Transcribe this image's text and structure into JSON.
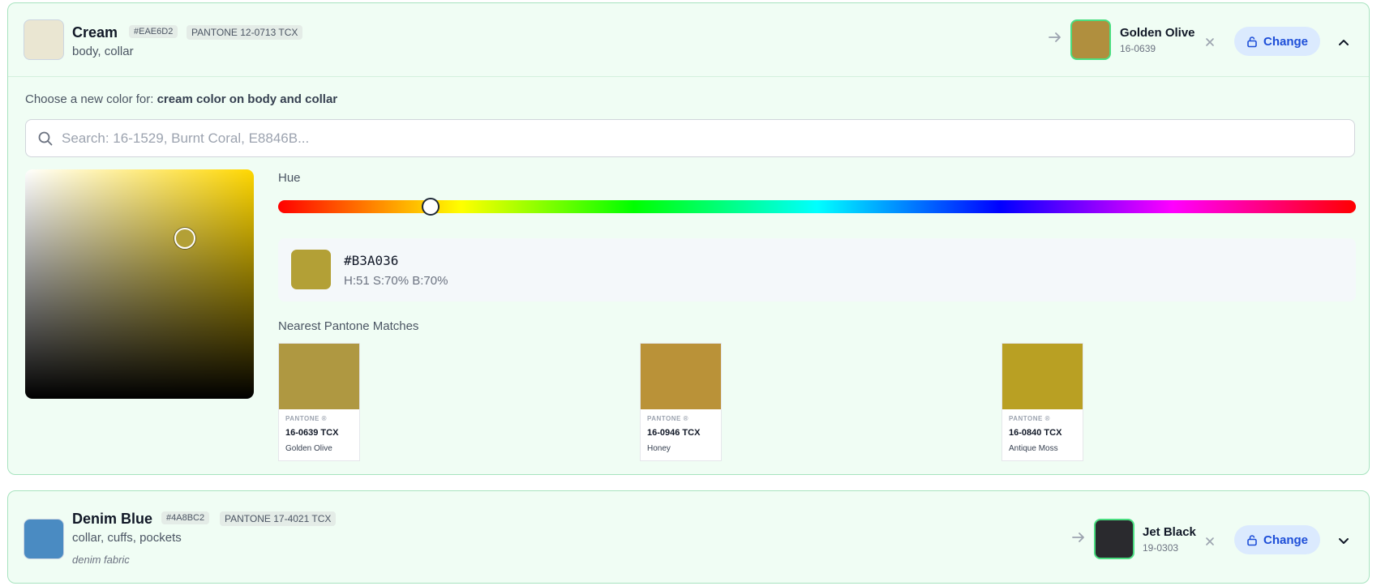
{
  "colors": {
    "card_bg": "#f0fdf4",
    "card_border": "#a7e3bf",
    "accent": "#1d4ed8",
    "change_bg": "#dbeafe",
    "selected_border": "#4ade80"
  },
  "items": [
    {
      "name": "Cream",
      "hex": "#EAE6D2",
      "hex_label": "#EAE6D2",
      "pantone": "PANTONE 12-0713 TCX",
      "usage": "body, collar",
      "note": "",
      "replacement": {
        "name": "Golden Olive",
        "code": "16-0639",
        "hex": "#B08F3E"
      },
      "change_label": "Change",
      "expanded": true
    },
    {
      "name": "Denim Blue",
      "hex": "#4A8BC2",
      "hex_label": "#4A8BC2",
      "pantone": "PANTONE 17-4021 TCX",
      "usage": "collar, cuffs, pockets",
      "note": "denim fabric",
      "replacement": {
        "name": "Jet Black",
        "code": "19-0303",
        "hex": "#2A2A2E"
      },
      "change_label": "Change",
      "expanded": false
    }
  ],
  "editor": {
    "prompt_prefix": "Choose a new color for:",
    "prompt_target": "cream color on body and collar",
    "search_placeholder": "Search: 16-1529, Burnt Coral, E8846B...",
    "search_value": "",
    "hue_label": "Hue",
    "hue_value": 51,
    "saturation": 0.7,
    "brightness": 0.7,
    "pure_hue_color": "#FFD700",
    "current_hex": "#B3A036",
    "current_hsb": "H:51 S:70% B:70%",
    "matches_label": "Nearest Pantone Matches",
    "matches": [
      {
        "brand": "PANTONE ®",
        "code": "16-0639 TCX",
        "name": "Golden Olive",
        "hex": "#AF9841"
      },
      {
        "brand": "PANTONE ®",
        "code": "16-0946 TCX",
        "name": "Honey",
        "hex": "#BA9238"
      },
      {
        "brand": "PANTONE ®",
        "code": "16-0840 TCX",
        "name": "Antique Moss",
        "hex": "#B9A023"
      }
    ]
  }
}
